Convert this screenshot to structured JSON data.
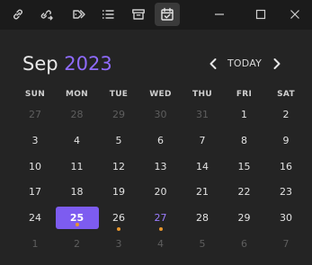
{
  "toolbar": {
    "icons": [
      "link-icon",
      "link-arrow-icon",
      "tags-icon",
      "list-icon",
      "archive-icon",
      "calendar-check-icon"
    ],
    "window_controls": [
      "minimize-icon",
      "maximize-icon",
      "close-icon"
    ]
  },
  "calendar": {
    "month": "Sep",
    "year": "2023",
    "today_label": "TODAY",
    "weekdays": [
      "SUN",
      "MON",
      "TUE",
      "WED",
      "THU",
      "FRI",
      "SAT"
    ],
    "weeks": [
      [
        {
          "d": "27",
          "muted": true
        },
        {
          "d": "28",
          "muted": true
        },
        {
          "d": "29",
          "muted": true
        },
        {
          "d": "30",
          "muted": true
        },
        {
          "d": "31",
          "muted": true
        },
        {
          "d": "1"
        },
        {
          "d": "2"
        }
      ],
      [
        {
          "d": "3"
        },
        {
          "d": "4"
        },
        {
          "d": "5"
        },
        {
          "d": "6"
        },
        {
          "d": "7"
        },
        {
          "d": "8"
        },
        {
          "d": "9"
        }
      ],
      [
        {
          "d": "10"
        },
        {
          "d": "11"
        },
        {
          "d": "12"
        },
        {
          "d": "13"
        },
        {
          "d": "14"
        },
        {
          "d": "15"
        },
        {
          "d": "16"
        }
      ],
      [
        {
          "d": "17"
        },
        {
          "d": "18"
        },
        {
          "d": "19"
        },
        {
          "d": "20"
        },
        {
          "d": "21"
        },
        {
          "d": "22"
        },
        {
          "d": "23"
        }
      ],
      [
        {
          "d": "24"
        },
        {
          "d": "25",
          "today": true,
          "dot": true
        },
        {
          "d": "26",
          "dot": true
        },
        {
          "d": "27",
          "accent": true,
          "dot": true
        },
        {
          "d": "28"
        },
        {
          "d": "29"
        },
        {
          "d": "30"
        }
      ],
      [
        {
          "d": "1",
          "muted": true
        },
        {
          "d": "2",
          "muted": true
        },
        {
          "d": "3",
          "muted": true
        },
        {
          "d": "4",
          "muted": true
        },
        {
          "d": "5",
          "muted": true
        },
        {
          "d": "6",
          "muted": true
        },
        {
          "d": "7",
          "muted": true
        }
      ]
    ]
  },
  "colors": {
    "accent": "#7d5cf0",
    "year": "#8f6bff",
    "event_dot": "#e8962c",
    "background": "#242424",
    "toolbar": "#1b1b1b"
  }
}
